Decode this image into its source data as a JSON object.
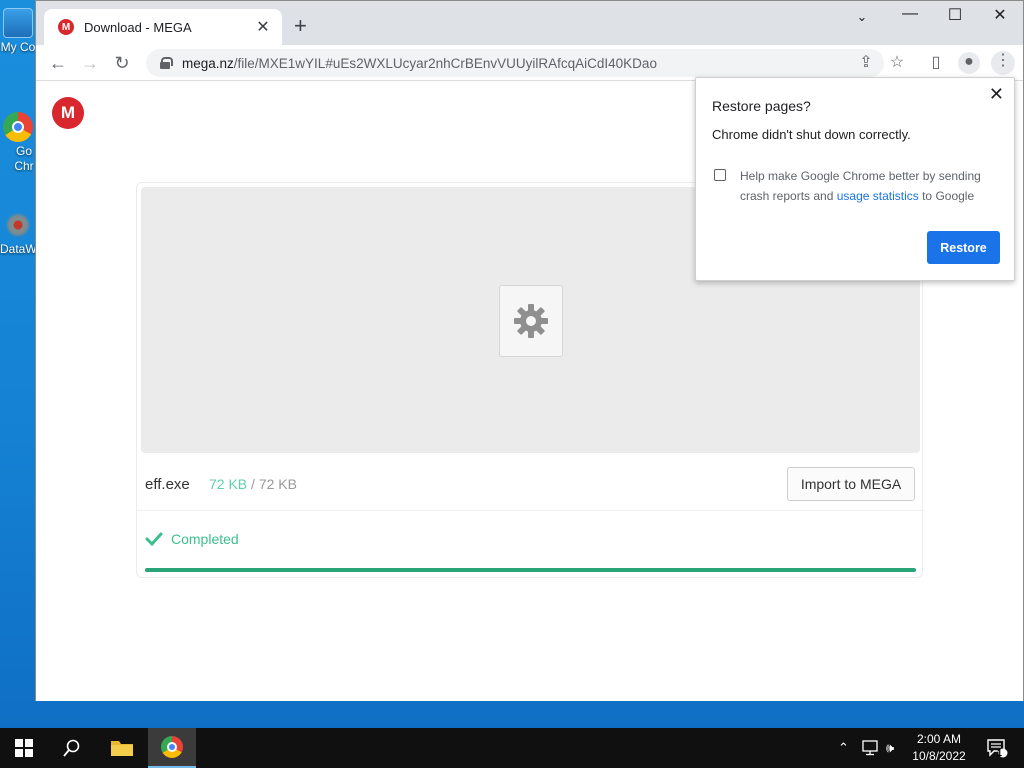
{
  "desktop": {
    "icons": [
      {
        "label": "My Co",
        "name": "my-computer"
      },
      {
        "label": "Go Chr",
        "name": "google-chrome"
      },
      {
        "label": "DataW",
        "name": "dataw"
      }
    ]
  },
  "browser": {
    "tab_title": "Download - MEGA",
    "tab_favicon": "M",
    "url_host": "mega.nz",
    "url_path": "/file/MXE1wYIL#uEs2WXLUcyar2nhCrBEnvVUUyilRAfcqAiCdI40KDao"
  },
  "page": {
    "logo_letter": "M",
    "file_name": "eff.exe",
    "downloaded": "72 KB",
    "separator": "/",
    "total_size": "72 KB",
    "import_label": "Import to MEGA",
    "status_label": "Completed",
    "progress": 1.0
  },
  "popup": {
    "title": "Restore pages?",
    "message": "Chrome didn't shut down correctly.",
    "checkbox_text_before": "Help make Google Chrome better by sending crash reports and ",
    "checkbox_link": "usage statistics",
    "checkbox_text_after": " to Google",
    "restore_label": "Restore"
  },
  "taskbar": {
    "time": "2:00 AM",
    "date": "10/8/2022",
    "notification_count": "1"
  },
  "colors": {
    "mega_red": "#d9272e",
    "chrome_blue": "#1a73e8",
    "mega_green": "#2aa579"
  }
}
